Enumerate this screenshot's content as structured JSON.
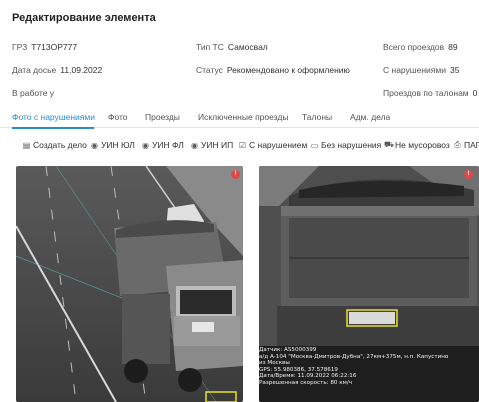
{
  "header": {
    "title": "Редактирование элемента"
  },
  "info": {
    "grz": {
      "label": "ГРЗ",
      "value": "Т713ОР777"
    },
    "dossier_date": {
      "label": "Дата досье",
      "value": "11.09.2022"
    },
    "in_work": {
      "label": "В работе у",
      "value": ""
    },
    "vehicle_type": {
      "label": "Тип ТС",
      "value": "Самосвал"
    },
    "status": {
      "label": "Статус",
      "value": "Рекомендовано к оформлению"
    },
    "total_passes": {
      "label": "Всего проездов",
      "value": "89"
    },
    "violations": {
      "label": "С нарушениями",
      "value": "35"
    },
    "coupon_passes": {
      "label": "Проездов по талонам",
      "value": "0"
    }
  },
  "tabs": [
    {
      "label": "Фото с нарушениями",
      "active": true
    },
    {
      "label": "Фото"
    },
    {
      "label": "Проезды"
    },
    {
      "label": "Исключенные проезды"
    },
    {
      "label": "Талоны"
    },
    {
      "label": "Адм. дела"
    }
  ],
  "toolbar": {
    "create_case": {
      "icon": "document-icon",
      "label": "Создать дело"
    },
    "uin_ul": {
      "icon": "radio-icon",
      "label": "УИН ЮЛ"
    },
    "uin_fl": {
      "icon": "radio-icon",
      "label": "УИН ФЛ"
    },
    "uin_ip": {
      "icon": "radio-icon",
      "label": "УИН ИП"
    },
    "with_violation": {
      "icon": "checkbox-icon",
      "label": "С нарушением"
    },
    "no_violation": {
      "icon": "image-icon",
      "label": "Без нарушения"
    },
    "not_garbage": {
      "icon": "truck-icon",
      "label": "Не мусоровоз"
    },
    "pap": {
      "icon": "printer-icon",
      "label": "ПАП"
    }
  },
  "photos": {
    "left": {
      "description": "dump truck on highway, overview camera",
      "badge": "!"
    },
    "right": {
      "description": "dump truck rear plate close-up",
      "badge": "!",
      "overlay": [
        "Датчик: AS5000399",
        "а/д А-104 \"Москва-Дмитров-Дубна\", 27км+375м, н.п. Капустино",
        "из Москвы",
        "GPS: 55.980386, 37.578619",
        "Дата/Время: 11.09.2022 06:22:16",
        "Разрешенная скорость: 80 км/ч"
      ]
    }
  },
  "colors": {
    "accent": "#2b8ad8",
    "badge": "#e04848",
    "plate_frame": "#e6e22a"
  }
}
